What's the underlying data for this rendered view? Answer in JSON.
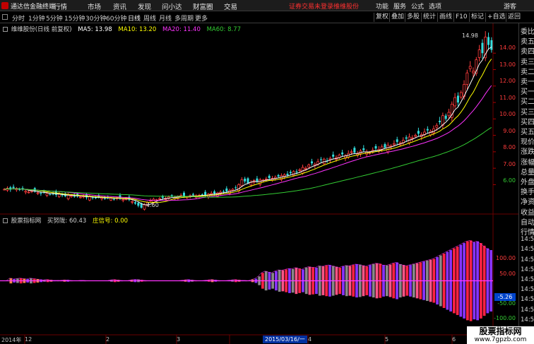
{
  "app": {
    "title": "通达信金融终端"
  },
  "menu": [
    "行情",
    "市场",
    "资讯",
    "发现",
    "问小达",
    "财富圈",
    "交易"
  ],
  "notice": {
    "login": "证券交易未登录",
    "stock_name": "维维股份"
  },
  "sysmenu": [
    "功能",
    "服务",
    "公式",
    "选项",
    "游客"
  ],
  "periods": [
    "分时",
    "1分钟",
    "5分钟",
    "15分钟",
    "30分钟",
    "60分钟",
    "日线",
    "周线",
    "月线",
    "多周期",
    "更多"
  ],
  "active_period": "日线",
  "tools": [
    "复权",
    "叠加",
    "多股",
    "统计",
    "画线",
    "F10",
    "标记",
    "+自选",
    "返回"
  ],
  "legend": {
    "stock": "维维股份(日线 前复权)",
    "ma5": "MA5: 13.98",
    "ma10": "MA10: 13.20",
    "ma20": "MA20: 11.40",
    "ma60": "MA60: 8.77"
  },
  "indicator": {
    "name": "股票指标网",
    "buy": "买努陇: 60.43",
    "signal": "庄信号: 0.00"
  },
  "price_axis": [
    "14.00",
    "13.00",
    "12.00",
    "11.00",
    "10.00",
    "9.00",
    "8.00",
    "7.00",
    "6.00"
  ],
  "ind_axis": [
    "100.00",
    "50.00",
    "-50.00",
    "-100.00"
  ],
  "annotations": {
    "high": "14.98",
    "low": "4.60",
    "current": "-5.26"
  },
  "x_axis": [
    "2014年",
    "12",
    "2",
    "3",
    "2015/03/16/一",
    "4",
    "5",
    "6"
  ],
  "right_panel": [
    "委比",
    "卖五",
    "卖四",
    "卖三",
    "卖二",
    "卖一",
    "买一",
    "买二",
    "买三",
    "买四",
    "买五",
    "现价",
    "涨跌",
    "涨幅",
    "总量",
    "外盘",
    "换手",
    "净资",
    "收益",
    "自动",
    "行情",
    "14:56",
    "14:56",
    "14:56",
    "14:56",
    "14:56",
    "14:56",
    "14:56",
    "14:56",
    "14:56",
    "14:56"
  ],
  "watermark": {
    "title": "股票指标网",
    "url": "www.7gpzb.com"
  },
  "colors": {
    "up": "#ff3c3c",
    "down": "#33dddd",
    "ma5": "#ffffff",
    "ma10": "#ffff00",
    "ma20": "#ff33ff",
    "ma60": "#33cc33",
    "bg": "#000000"
  },
  "chart_data": {
    "type": "candlestick",
    "ylim": [
      4.3,
      15.3
    ],
    "candles_note": "Daily OHLC, approx, ~ one per bar",
    "close": [
      5.72,
      5.78,
      5.7,
      5.8,
      5.75,
      5.68,
      5.72,
      5.6,
      5.55,
      5.62,
      5.58,
      5.5,
      5.45,
      5.52,
      5.48,
      5.4,
      5.45,
      5.38,
      5.42,
      5.35,
      5.3,
      5.38,
      5.33,
      5.28,
      5.32,
      5.25,
      5.3,
      5.22,
      5.28,
      5.2,
      5.18,
      5.25,
      5.2,
      5.15,
      5.22,
      5.18,
      5.12,
      5.2,
      5.14,
      5.1,
      5.16,
      5.08,
      4.98,
      4.85,
      4.72,
      4.6,
      4.78,
      4.92,
      5.05,
      5.12,
      5.08,
      5.15,
      5.2,
      5.18,
      5.25,
      5.3,
      5.22,
      5.28,
      5.35,
      5.3,
      5.25,
      5.32,
      5.38,
      5.3,
      5.35,
      5.4,
      5.36,
      5.42,
      5.48,
      5.45,
      5.5,
      5.55,
      5.6,
      5.58,
      5.65,
      5.72,
      5.8,
      6.0,
      6.3,
      6.2,
      6.1,
      6.15,
      6.25,
      6.2,
      6.3,
      6.28,
      6.35,
      6.4,
      6.38,
      6.45,
      6.5,
      6.55,
      6.6,
      6.58,
      6.7,
      6.8,
      6.75,
      6.9,
      7.05,
      7.0,
      7.2,
      7.3,
      7.25,
      7.4,
      7.5,
      7.55,
      7.45,
      7.6,
      7.7,
      7.65,
      7.8,
      7.85,
      7.75,
      7.9,
      8.0,
      7.95,
      7.88,
      8.05,
      8.1,
      8.0,
      7.95,
      8.1,
      8.2,
      8.15,
      8.3,
      8.25,
      8.4,
      8.35,
      8.5,
      8.6,
      8.55,
      8.7,
      8.8,
      8.9,
      8.85,
      9.0,
      9.1,
      9.05,
      9.2,
      9.3,
      9.25,
      9.4,
      9.6,
      9.8,
      10.2,
      10.0,
      10.4,
      10.9,
      11.3,
      11.0,
      11.6,
      12.1,
      12.8,
      13.2,
      12.9,
      13.6,
      14.2,
      14.0,
      14.98,
      14.5,
      14.2
    ]
  },
  "indicator_data": {
    "type": "bar",
    "ylim": [
      -120,
      120
    ],
    "amplitude": [
      0,
      0,
      6,
      4,
      5,
      6,
      5,
      4,
      6,
      5,
      4,
      3,
      2,
      3,
      2,
      1,
      1,
      1,
      2,
      2,
      1,
      0,
      0,
      1,
      1,
      0,
      0,
      0,
      0,
      0,
      0,
      0,
      2,
      3,
      2,
      1,
      0,
      0,
      2,
      3,
      3,
      2,
      1,
      0,
      0,
      0,
      0,
      0,
      0,
      0,
      0,
      0,
      0,
      1,
      2,
      3,
      2,
      1,
      0,
      0,
      1,
      2,
      3,
      2,
      1,
      0,
      0,
      1,
      2,
      3,
      2,
      1,
      1,
      0,
      3,
      5,
      10,
      18,
      22,
      20,
      18,
      22,
      25,
      24,
      26,
      28,
      27,
      30,
      28,
      26,
      30,
      32,
      31,
      30,
      34,
      33,
      35,
      36,
      34,
      32,
      30,
      33,
      35,
      34,
      36,
      38,
      37,
      35,
      33,
      36,
      38,
      40,
      39,
      36,
      35,
      37,
      40,
      42,
      38,
      36,
      34,
      36,
      38,
      40,
      42,
      44,
      46,
      48,
      50,
      54,
      58,
      62,
      66,
      70,
      74,
      78,
      82,
      86,
      90,
      92,
      88,
      90,
      86,
      80,
      74,
      70
    ]
  }
}
